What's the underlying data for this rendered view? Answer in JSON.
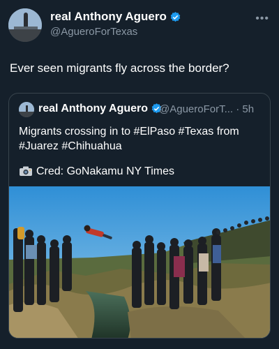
{
  "post": {
    "author_name": "real Anthony Aguero",
    "author_handle": "@AgueroForTexas",
    "text": "Ever seen migrants fly across the border?",
    "more_icon": "more-dots-icon",
    "verified_icon": "verified-badge-icon"
  },
  "quoted": {
    "author_name": "real Anthony Aguero",
    "handle_time": "@AgueroForT... · 5h",
    "text": "Migrants crossing in to #ElPaso #Texas from #Juarez #Chihuahua",
    "credit": "Cred: GoNakamu NY Times",
    "credit_icon": "camera-icon",
    "photo_icon": "photo-image"
  },
  "colors": {
    "background": "#15202b",
    "verified": "#1d9bf0",
    "secondary_text": "#8b98a5",
    "border": "#38444d"
  }
}
